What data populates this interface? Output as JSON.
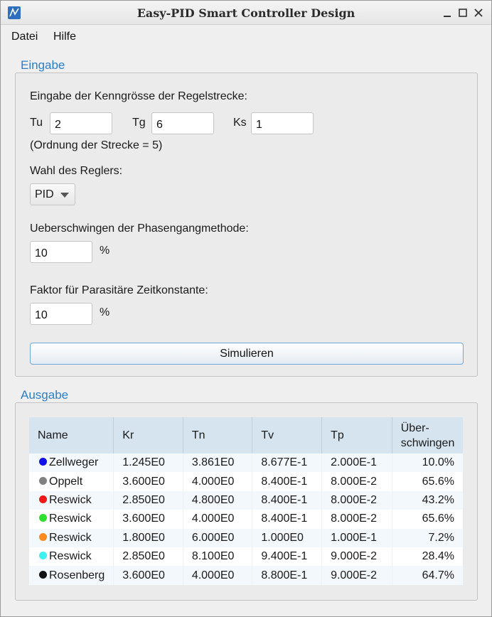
{
  "window": {
    "title": "Easy-PID Smart Controller Design"
  },
  "menu": {
    "items": [
      "Datei",
      "Hilfe"
    ]
  },
  "input_group": {
    "title": "Eingabe",
    "heading": "Eingabe der Kenngrösse der Regelstrecke:",
    "tu_label": "Tu",
    "tu_value": "2",
    "tg_label": "Tg",
    "tg_value": "6",
    "ks_label": "Ks",
    "ks_value": "1",
    "order_text": "(Ordnung der Strecke = 5)",
    "controller_label": "Wahl des Reglers:",
    "controller_value": "PID",
    "overshoot_label": "Ueberschwingen der Phasengangmethode:",
    "overshoot_value": "10",
    "overshoot_unit": "%",
    "factor_label": "Faktor für Parasitäre Zeitkonstante:",
    "factor_value": "10",
    "factor_unit": "%",
    "simulate_label": "Simulieren"
  },
  "output_group": {
    "title": "Ausgabe",
    "columns": [
      "Name",
      "Kr",
      "Tn",
      "Tv",
      "Tp",
      "Über-\nschwingen"
    ],
    "rows": [
      {
        "color": "#1010e8",
        "name": "Zellweger",
        "kr": "1.245E0",
        "tn": "3.861E0",
        "tv": "8.677E-1",
        "tp": "2.000E-1",
        "os": "10.0%"
      },
      {
        "color": "#808080",
        "name": "Oppelt",
        "kr": "3.600E0",
        "tn": "4.000E0",
        "tv": "8.400E-1",
        "tp": "8.000E-2",
        "os": "65.6%"
      },
      {
        "color": "#f01818",
        "name": "Reswick",
        "kr": "2.850E0",
        "tn": "4.800E0",
        "tv": "8.400E-1",
        "tp": "8.000E-2",
        "os": "43.2%"
      },
      {
        "color": "#30e030",
        "name": "Reswick",
        "kr": "3.600E0",
        "tn": "4.000E0",
        "tv": "8.400E-1",
        "tp": "8.000E-2",
        "os": "65.6%"
      },
      {
        "color": "#ff8a1e",
        "name": "Reswick",
        "kr": "1.800E0",
        "tn": "6.000E0",
        "tv": "1.000E0",
        "tp": "1.000E-1",
        "os": "7.2%"
      },
      {
        "color": "#3ef0f0",
        "name": "Reswick",
        "kr": "2.850E0",
        "tn": "8.100E0",
        "tv": "9.400E-1",
        "tp": "9.000E-2",
        "os": "28.4%"
      },
      {
        "color": "#111111",
        "name": "Rosenberg",
        "kr": "3.600E0",
        "tn": "4.000E0",
        "tv": "8.800E-1",
        "tp": "9.000E-2",
        "os": "64.7%"
      }
    ]
  }
}
